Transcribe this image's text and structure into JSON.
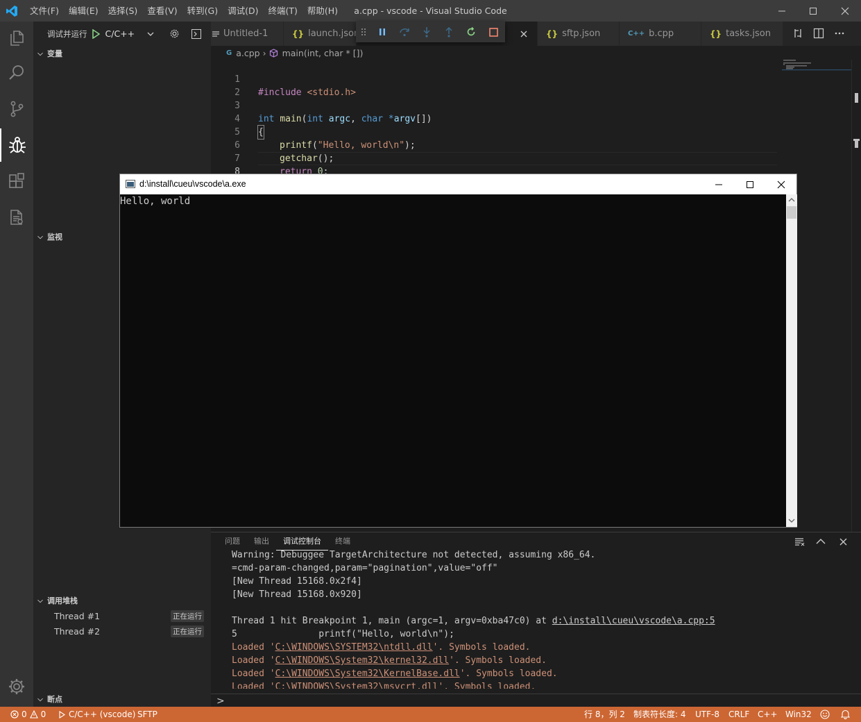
{
  "window": {
    "menu": [
      "文件(F)",
      "编辑(E)",
      "选择(S)",
      "查看(V)",
      "转到(G)",
      "调试(D)",
      "终端(T)",
      "帮助(H)"
    ],
    "title": "a.cpp - vscode - Visual Studio Code"
  },
  "sidebar": {
    "run_label": "调试并运行",
    "config": "C/C++",
    "sections": {
      "variables": "变量",
      "watch": "监视",
      "callstack": "调用堆栈",
      "breakpoints": "断点"
    },
    "threads": [
      {
        "name": "Thread #1",
        "status": "正在运行"
      },
      {
        "name": "Thread #2",
        "status": "正在运行"
      }
    ]
  },
  "tabs": [
    {
      "label": "Untitled-1",
      "icon": "lines-icon"
    },
    {
      "label": "launch.json",
      "icon": "{}"
    },
    {
      "label": "sftp.json",
      "icon": "{}"
    },
    {
      "label": "b.cpp",
      "icon": "C++"
    },
    {
      "label": "tasks.json",
      "icon": "{}"
    }
  ],
  "breadcrumb": {
    "file": "a.cpp",
    "symbol": "main(int, char * [])"
  },
  "code": {
    "line_numbers": [
      "1",
      "2",
      "3",
      "4",
      "5",
      "6",
      "7",
      "8"
    ],
    "l1_directive": "#include",
    "l1_header": "<stdio.h>",
    "l3": {
      "t1": "int",
      "t2": "main",
      "t3": "(",
      "t4": "int",
      "t5": "argc",
      "t6": ", ",
      "t7": "char",
      "t8": "*",
      "t9": "argv",
      "t10": "[])"
    },
    "l4": "{",
    "l5": {
      "fn": "printf",
      "open": "(",
      "str": "\"Hello, world\\n\"",
      "close": ");"
    },
    "l6": {
      "fn": "getchar",
      "rest": "();"
    },
    "l7": {
      "kw": "return",
      "num": "0",
      "rest": ";"
    },
    "l8": "}"
  },
  "console_window": {
    "title": "d:\\install\\cueu\\vscode\\a.exe",
    "output": "Hello, world"
  },
  "panel": {
    "tabs": [
      "问题",
      "输出",
      "调试控制台",
      "终端"
    ],
    "active_tab": "调试控制台",
    "lines": {
      "l1": "Warning: Debuggee TargetArchitecture not detected, assuming x86_64.",
      "l2": "=cmd-param-changed,param=\"pagination\",value=\"off\"",
      "l3": "[New Thread 15168.0x2f4]",
      "l4": "[New Thread 15168.0x920]",
      "l6_prefix": "Thread 1 hit Breakpoint 1, main (argc=1, argv=0xba47c0) at ",
      "l6_link": "d:\\install\\cueu\\vscode\\a.cpp:5",
      "l7": "5               printf(\"Hello, world\\n\");",
      "loaded": [
        {
          "pre": "Loaded '",
          "path": "C:\\WINDOWS\\SYSTEM32\\ntdll.dll",
          "post": "'. Symbols loaded."
        },
        {
          "pre": "Loaded '",
          "path": "C:\\WINDOWS\\System32\\kernel32.dll",
          "post": "'. Symbols loaded."
        },
        {
          "pre": "Loaded '",
          "path": "C:\\WINDOWS\\System32\\KernelBase.dll",
          "post": "'. Symbols loaded."
        },
        {
          "pre": "Loaded '",
          "path": "C:\\WINDOWS\\System32\\msvcrt.dll",
          "post": "'. Symbols loaded."
        }
      ]
    },
    "prompt": ">"
  },
  "statusbar": {
    "errors": "0",
    "warnings": "0",
    "debug": "C/C++ (vscode)",
    "sftp": "SFTP",
    "position": "行 8，列 2",
    "tabsize": "制表符长度: 4",
    "encoding": "UTF-8",
    "eol": "CRLF",
    "language": "C++",
    "platform": "Win32"
  },
  "colors": {
    "statusbar": "#cc6633",
    "accent": "#007acc"
  }
}
